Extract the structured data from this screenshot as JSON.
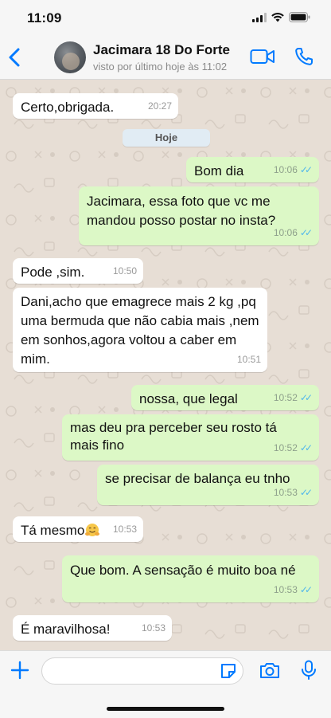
{
  "status": {
    "time": "11:09"
  },
  "header": {
    "contact_name": "Jacimara 18 Do Forte",
    "last_seen": "visto por último hoje às 11:02"
  },
  "chat": {
    "date_label": "Hoje",
    "messages": [
      {
        "dir": "in",
        "text": "Certo,obrigada.",
        "time": "20:27"
      },
      {
        "dir": "out",
        "text": "Bom dia",
        "time": "10:06",
        "read": true
      },
      {
        "dir": "out",
        "text": "Jacimara, essa foto que vc me mandou posso postar no insta?",
        "time": "10:06",
        "read": true
      },
      {
        "dir": "in",
        "text": "Pode ,sim.",
        "time": "10:50"
      },
      {
        "dir": "in",
        "text": "Dani,acho que emagrece mais 2 kg ,pq uma bermuda que não cabia mais ,nem em sonhos,agora voltou a caber em mim.",
        "time": "10:51"
      },
      {
        "dir": "out",
        "text": "nossa, que legal",
        "time": "10:52",
        "read": true
      },
      {
        "dir": "out",
        "text": "mas deu pra perceber seu rosto tá mais fino",
        "time": "10:52",
        "read": true
      },
      {
        "dir": "out",
        "text": "se precisar de balança eu tnho",
        "time": "10:53",
        "read": true
      },
      {
        "dir": "in",
        "text": "Tá mesmo",
        "time": "10:53",
        "emoji": "hugging-face"
      },
      {
        "dir": "out",
        "text": "Que bom. A sensação é muito boa né",
        "time": "10:53",
        "read": true
      },
      {
        "dir": "in",
        "text": "É maravilhosa!",
        "time": "10:53"
      }
    ]
  },
  "composer": {
    "placeholder": ""
  },
  "colors": {
    "accent": "#007aff",
    "outgoing": "#dcf8c6",
    "incoming": "#ffffff",
    "read_ticks": "#4fb6ec"
  }
}
